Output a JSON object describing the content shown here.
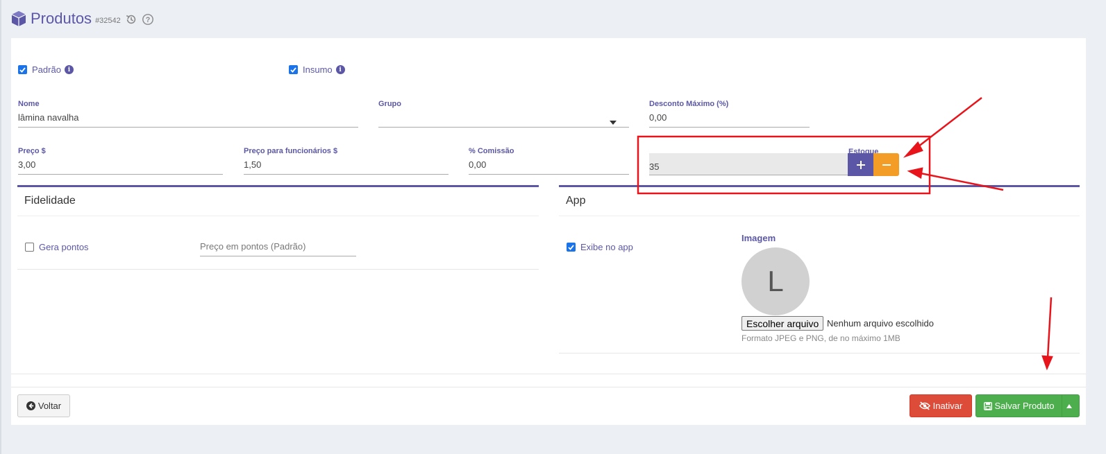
{
  "header": {
    "title": "Produtos",
    "product_id": "#32542"
  },
  "flags": {
    "padrao_label": "Padrão",
    "insumo_label": "Insumo",
    "padrao_checked": true,
    "insumo_checked": true
  },
  "form": {
    "nome": {
      "label": "Nome",
      "value": "lâmina navalha"
    },
    "grupo": {
      "label": "Grupo",
      "value": ""
    },
    "desconto": {
      "label": "Desconto Máximo (%)",
      "value": "0,00"
    },
    "preco": {
      "label": "Preço $",
      "value": "3,00"
    },
    "preco_func": {
      "label": "Preço para funcionários $",
      "value": "1,50"
    },
    "comissao": {
      "label": "% Comissão",
      "value": "0,00"
    },
    "estoque": {
      "label": "Estoque",
      "value": "35"
    }
  },
  "fidelidade": {
    "title": "Fidelidade",
    "gera_pontos_label": "Gera pontos",
    "gera_pontos_checked": false,
    "preco_pontos_placeholder": "Preço em pontos (Padrão)"
  },
  "app": {
    "title": "App",
    "exibe_label": "Exibe no app",
    "exibe_checked": true,
    "imagem_label": "Imagem",
    "avatar_letter": "L",
    "file_button": "Escolher arquivo",
    "file_status": "Nenhum arquivo escolhido",
    "file_hint": "Formato JPEG e PNG, de no máximo 1MB"
  },
  "footer": {
    "voltar": "Voltar",
    "inativar": "Inativar",
    "salvar": "Salvar Produto"
  },
  "colors": {
    "primary": "#5b57a6",
    "warning": "#f39c26",
    "danger": "#dd4b39",
    "success": "#4cae4c",
    "annotation": "#e8141b"
  }
}
